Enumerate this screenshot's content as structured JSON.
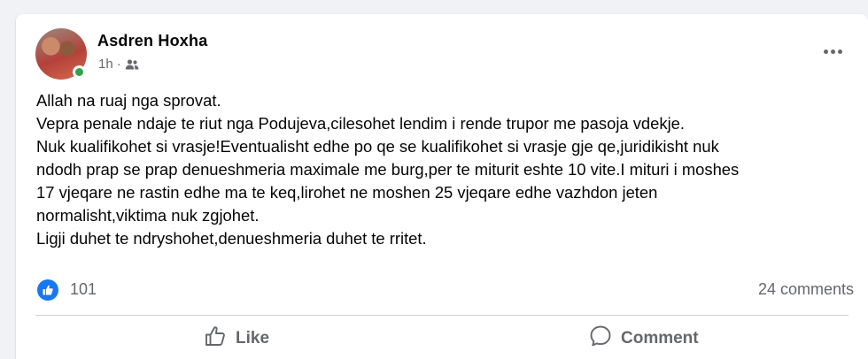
{
  "post": {
    "author": "Asdren Hoxha",
    "time": "1h",
    "separator": "·",
    "audience_icon": "friends-icon",
    "more_icon": "more-options-icon",
    "lines": [
      "Allah na ruaj nga sprovat.",
      "Vepra penale ndaje te riut nga Podujeva,cilesohet lendim i rende trupor me pasoja vdekje.",
      "Nuk kualifikohet si vrasje!Eventualisht edhe po qe se kualifikohet si vrasje gje qe,juridikisht nuk",
      "ndodh prap se prap denueshmeria maximale me burg,per te miturit eshte 10 vite.I mituri i moshes",
      "17 vjeqare ne rastin edhe ma te keq,lirohet ne moshen 25 vjeqare edhe vazhdon jeten",
      "normalisht,viktima nuk zgjohet.",
      "Ligji duhet te ndryshohet,denueshmeria duhet te rritet."
    ]
  },
  "stats": {
    "reactions": "101",
    "comments": "24 comments"
  },
  "actions": {
    "like_label": "Like",
    "comment_label": "Comment"
  },
  "colors": {
    "accent": "#1877f2",
    "online": "#31a24c",
    "secondary_text": "#65676b"
  }
}
